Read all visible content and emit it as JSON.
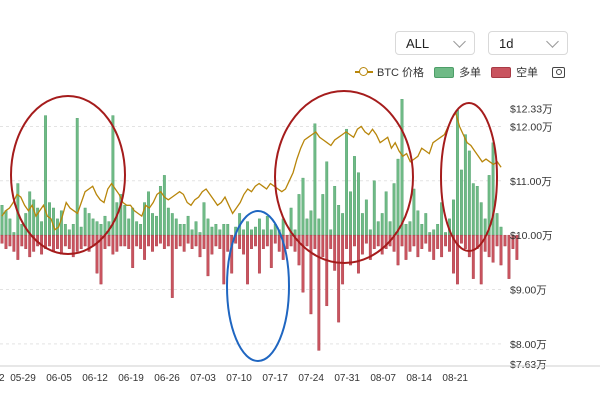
{
  "controls": {
    "range": {
      "value": "ALL"
    },
    "interval": {
      "value": "1d"
    }
  },
  "legend": {
    "price_label": "BTC 价格",
    "long_label": "多单",
    "short_label": "空单"
  },
  "colors": {
    "long": "#6fba86",
    "short": "#c9545f",
    "price": "#b8860b",
    "red_ellipse": "#a51c1c",
    "blue_ellipse": "#1f66c1"
  },
  "chart_data": {
    "type": "bar",
    "title": "",
    "xlabel": "",
    "ylabel": "",
    "x_ticks": [
      "2",
      "05-29",
      "06-05",
      "06-12",
      "06-19",
      "06-26",
      "07-03",
      "07-10",
      "07-17",
      "07-24",
      "07-31",
      "08-07",
      "08-14",
      "08-21"
    ],
    "y_ticks": [
      "$12.33万",
      "$12.00万",
      "$11.00万",
      "$10.00万",
      "$9.00万",
      "$8.00万",
      "$7.63万"
    ],
    "y_tick_values": [
      12.33,
      12.0,
      11.0,
      10.0,
      9.0,
      8.0,
      7.63
    ],
    "ylim": [
      7.63,
      12.33
    ],
    "baseline": 10.0,
    "legend_position": "top-right",
    "grid": true,
    "series": [
      {
        "name": "多单",
        "values": [
          10.55,
          10.45,
          10.3,
          10.05,
          10.95,
          10.2,
          10.4,
          10.8,
          10.65,
          10.5,
          10.25,
          12.2,
          10.6,
          10.5,
          10.3,
          10.45,
          10.2,
          10.1,
          10.2,
          12.15,
          10.15,
          10.5,
          10.4,
          10.3,
          10.25,
          10.2,
          10.35,
          10.25,
          12.2,
          10.6,
          10.75,
          10.55,
          10.3,
          10.5,
          10.25,
          10.2,
          10.6,
          10.8,
          10.4,
          10.35,
          10.9,
          11.1,
          10.5,
          10.4,
          10.3,
          10.2,
          10.2,
          10.35,
          10.1,
          10.25,
          10.05,
          10.6,
          10.3,
          10.15,
          10.2,
          10.1,
          10.2,
          10.2,
          10.0,
          10.15,
          10.4,
          10.1,
          10.25,
          10.1,
          10.15,
          10.3,
          10.1,
          10.35,
          10.1,
          10.2,
          10.1,
          10.3,
          10.0,
          10.5,
          10.1,
          10.75,
          11.05,
          10.3,
          10.45,
          12.05,
          10.3,
          10.75,
          11.35,
          10.1,
          10.9,
          10.55,
          10.4,
          11.95,
          10.8,
          11.45,
          11.15,
          10.4,
          10.65,
          10.1,
          11.0,
          10.25,
          10.4,
          10.8,
          10.25,
          10.95,
          11.4,
          12.5,
          10.2,
          10.25,
          10.85,
          10.45,
          10.2,
          10.4,
          10.05,
          10.1,
          10.2,
          10.6,
          10.05,
          10.3,
          10.65,
          12.3,
          11.2,
          11.85,
          11.55,
          10.95,
          10.9,
          10.6,
          10.3,
          11.1,
          11.7,
          10.4,
          10.15
        ],
        "short_values": []
      },
      {
        "name": "空单",
        "values": [
          9.85,
          9.75,
          9.8,
          9.7,
          9.55,
          9.8,
          9.75,
          9.6,
          9.7,
          9.8,
          9.65,
          9.75,
          9.8,
          9.7,
          9.75,
          9.65,
          9.8,
          9.75,
          9.6,
          9.7,
          9.75,
          9.8,
          9.7,
          9.8,
          9.3,
          9.1,
          9.75,
          9.8,
          9.65,
          9.7,
          9.8,
          9.8,
          9.75,
          9.4,
          9.8,
          9.75,
          9.55,
          9.8,
          9.7,
          9.8,
          9.85,
          9.75,
          9.8,
          8.85,
          9.75,
          9.8,
          9.7,
          9.85,
          9.75,
          9.8,
          9.6,
          9.75,
          9.25,
          9.65,
          9.8,
          9.75,
          9.1,
          9.7,
          9.3,
          9.85,
          9.75,
          9.65,
          9.1,
          9.75,
          9.8,
          9.3,
          9.75,
          9.8,
          9.4,
          9.85,
          9.7,
          9.55,
          9.75,
          9.8,
          9.7,
          9.45,
          8.95,
          9.8,
          8.55,
          9.75,
          7.88,
          9.6,
          8.7,
          9.75,
          9.35,
          8.4,
          9.1,
          9.75,
          9.45,
          9.8,
          9.3,
          9.65,
          9.85,
          9.55,
          9.75,
          9.8,
          9.65,
          9.75,
          9.8,
          9.7,
          9.45,
          9.8,
          9.55,
          9.7,
          9.8,
          9.6,
          9.75,
          9.85,
          9.7,
          9.55,
          9.75,
          9.6,
          9.8,
          9.7,
          9.3,
          9.1,
          9.85,
          9.75,
          9.6,
          9.2,
          9.75,
          9.1,
          9.7,
          9.6,
          9.5,
          9.8,
          9.45,
          9.8,
          9.2,
          9.75,
          9.55
        ]
      },
      {
        "name": "BTC 价格",
        "values": [
          10.35,
          10.45,
          10.5,
          10.6,
          10.75,
          10.7,
          10.55,
          10.45,
          10.55,
          10.35,
          10.45,
          10.55,
          10.35,
          10.3,
          10.1,
          10.15,
          10.35,
          10.6,
          10.5,
          10.45,
          10.4,
          10.6,
          10.8,
          10.85,
          10.9,
          10.75,
          10.65,
          10.6,
          10.85,
          10.95,
          10.85,
          10.75,
          10.6,
          10.55,
          10.55,
          10.45,
          10.4,
          10.35,
          10.55,
          10.5,
          10.6,
          10.75,
          10.8,
          10.7,
          10.65,
          10.7,
          10.75,
          10.8,
          10.75,
          10.6,
          10.55,
          10.65,
          10.7,
          10.8,
          10.85,
          10.75,
          10.65,
          10.55,
          10.6,
          10.7,
          10.55,
          10.4,
          10.5,
          10.6,
          10.75,
          10.85,
          10.8,
          10.9,
          10.95,
          10.9,
          10.85,
          10.95,
          10.9,
          10.85,
          10.8,
          10.85,
          11.0,
          11.15,
          11.4,
          11.6,
          11.75,
          11.8,
          11.85,
          11.9,
          11.8,
          11.75,
          11.7,
          11.65,
          11.75,
          11.8,
          11.85,
          11.9,
          11.85,
          11.8,
          11.95,
          12.0,
          11.9,
          11.85,
          11.95,
          11.85,
          11.7,
          11.75,
          11.8,
          11.6,
          11.7,
          11.55,
          11.45,
          11.5,
          11.35,
          11.4,
          11.45,
          11.6,
          11.55,
          11.5,
          11.7,
          11.75,
          11.8,
          11.85,
          12.0,
          12.15,
          12.25,
          12.0,
          11.85,
          11.7,
          11.65,
          11.55,
          11.45,
          11.35,
          11.4,
          11.35,
          11.3,
          11.35,
          11.25
        ]
      }
    ]
  }
}
